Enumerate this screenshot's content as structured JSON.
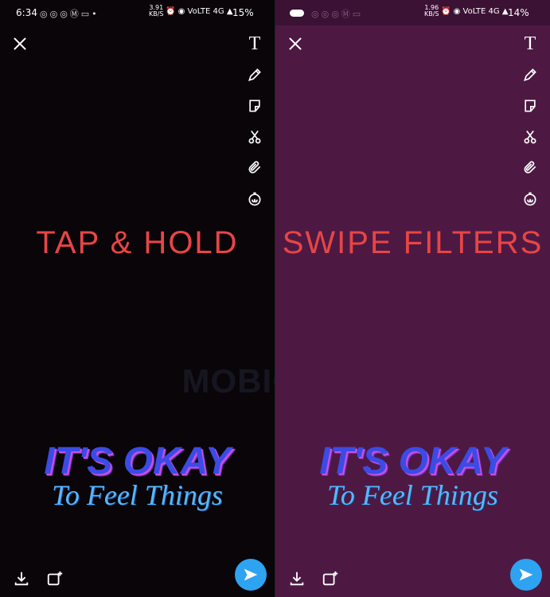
{
  "left_panel": {
    "status": {
      "time": "6:34",
      "net_rate": "3.91",
      "net_unit": "KB/S",
      "battery": "15%",
      "volte": "VoLTE",
      "network": "4G"
    },
    "caption": "TAP & HOLD"
  },
  "right_panel": {
    "status": {
      "net_rate": "1.96",
      "net_unit": "KB/S",
      "battery": "14%",
      "volte": "VoLTE",
      "network": "4G"
    },
    "caption": "SWIPE FILTERS"
  },
  "sticker": {
    "line1": "IT'S OKAY",
    "line2": "To Feel Things"
  },
  "watermark": "MOBIGYAAN",
  "toolbar": {
    "tools": [
      "text-icon",
      "pencil-icon",
      "sticker-icon",
      "scissors-icon",
      "paperclip-icon",
      "timer-icon"
    ],
    "text_tool_glyph": "T"
  },
  "colors": {
    "caption": "#e84545",
    "left_bg": "#0a0509",
    "right_bg": "#4d1943",
    "send": "#2ea3f2"
  }
}
